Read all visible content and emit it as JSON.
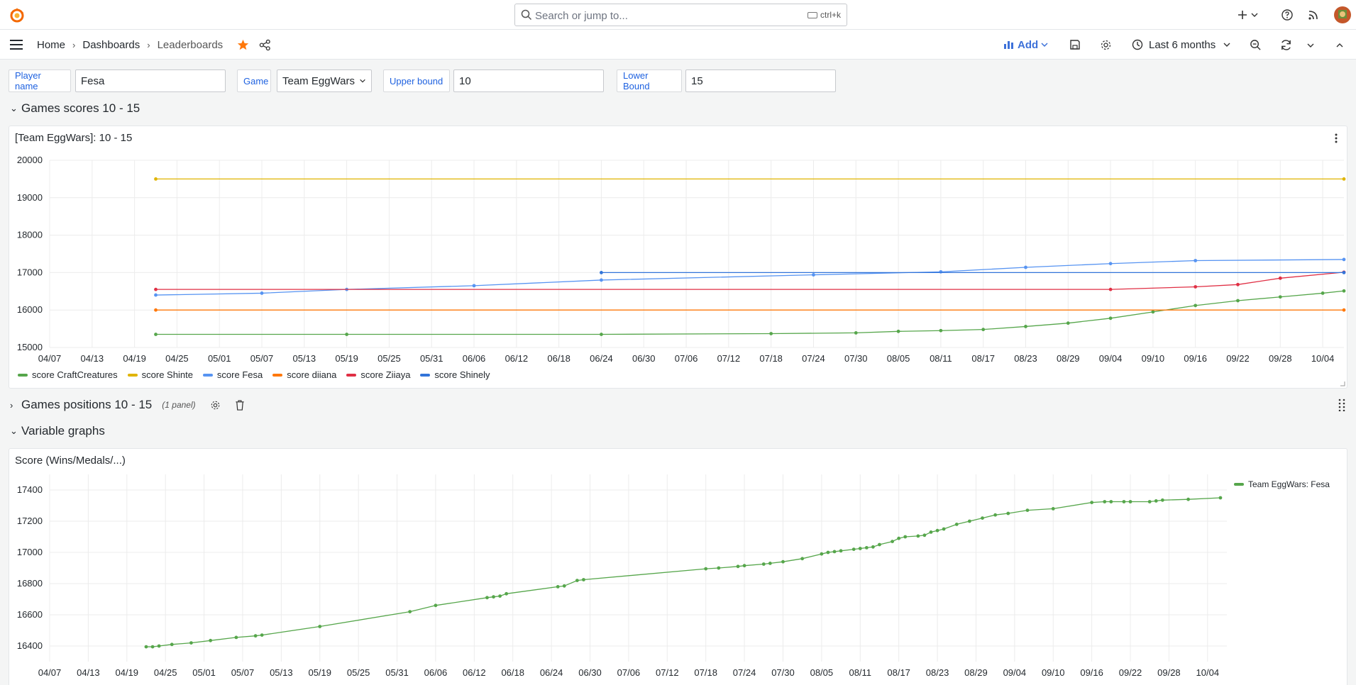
{
  "topbar": {
    "search_placeholder": "Search or jump to...",
    "search_shortcut": "ctrl+k",
    "icons": [
      "grafana-logo-icon",
      "plus-icon",
      "chevron-down-icon",
      "help-icon",
      "rss-icon",
      "user-avatar"
    ]
  },
  "navbar": {
    "breadcrumbs": [
      "Home",
      "Dashboards",
      "Leaderboards"
    ],
    "add_label": "Add",
    "time_range": "Last 6 months"
  },
  "variables": [
    {
      "label": "Player name",
      "value": "Fesa"
    },
    {
      "label": "Game",
      "value": "Team EggWars"
    },
    {
      "label": "Upper bound",
      "value": "10"
    },
    {
      "label": "Lower Bound",
      "value": "15"
    }
  ],
  "rows": {
    "games_scores": {
      "title": "Games scores 10 - 15"
    },
    "games_positions": {
      "title": "Games positions 10 - 15",
      "panel_count": "(1 panel)"
    },
    "variable_graphs": {
      "title": "Variable graphs"
    }
  },
  "colors": {
    "green": "#56a64b",
    "yellow": "#e0b400",
    "lightblue": "#5794f2",
    "orange": "#ff780a",
    "red": "#e02f44",
    "blue": "#3274d9",
    "accent": "#3d71d9",
    "star": "#ff780a"
  },
  "chart_data": [
    {
      "type": "line",
      "title": "[Team EggWars]: 10 - 15",
      "x_ticks": [
        "04/07",
        "04/13",
        "04/19",
        "04/25",
        "05/01",
        "05/07",
        "05/13",
        "05/19",
        "05/25",
        "05/31",
        "06/06",
        "06/12",
        "06/18",
        "06/24",
        "06/30",
        "07/06",
        "07/12",
        "07/18",
        "07/24",
        "07/30",
        "08/05",
        "08/11",
        "08/17",
        "08/23",
        "08/29",
        "09/04",
        "09/10",
        "09/16",
        "09/22",
        "09/28",
        "10/04"
      ],
      "ylim": [
        15000,
        20000
      ],
      "y_ticks": [
        15000,
        16000,
        17000,
        18000,
        19000,
        20000
      ],
      "grid": true,
      "legend_placement": "bottom",
      "series": [
        {
          "name": "score CraftCreatures",
          "color": "green",
          "x": [
            "04/22",
            "05/19",
            "06/24",
            "07/18",
            "07/30",
            "08/05",
            "08/11",
            "08/17",
            "08/23",
            "08/29",
            "09/04",
            "09/10",
            "09/16",
            "09/22",
            "09/28",
            "10/04",
            "10/07"
          ],
          "y": [
            15350,
            15350,
            15350,
            15370,
            15390,
            15430,
            15450,
            15480,
            15560,
            15650,
            15780,
            15950,
            16120,
            16250,
            16350,
            16450,
            16510
          ]
        },
        {
          "name": "score Shinte",
          "color": "yellow",
          "x": [
            "04/22",
            "10/07"
          ],
          "y": [
            19500,
            19500
          ]
        },
        {
          "name": "score Fesa",
          "color": "lightblue",
          "x": [
            "04/22",
            "05/07",
            "05/19",
            "06/06",
            "06/24",
            "07/24",
            "08/11",
            "08/23",
            "09/04",
            "09/16",
            "10/07"
          ],
          "y": [
            16400,
            16450,
            16550,
            16650,
            16800,
            16940,
            17020,
            17140,
            17240,
            17320,
            17350
          ]
        },
        {
          "name": "score diiana",
          "color": "orange",
          "x": [
            "04/22",
            "10/07"
          ],
          "y": [
            16000,
            16000
          ]
        },
        {
          "name": "score Ziiaya",
          "color": "red",
          "x": [
            "04/22",
            "09/04",
            "09/16",
            "09/22",
            "09/28",
            "10/07"
          ],
          "y": [
            16550,
            16550,
            16620,
            16680,
            16850,
            17010
          ]
        },
        {
          "name": "score Shinely",
          "color": "blue",
          "x": [
            "06/24",
            "10/07"
          ],
          "y": [
            17000,
            17000
          ]
        }
      ]
    },
    {
      "type": "line",
      "title": "Score (Wins/Medals/...)",
      "x_ticks": [
        "04/07",
        "04/13",
        "04/19",
        "04/25",
        "05/01",
        "05/07",
        "05/13",
        "05/19",
        "05/25",
        "05/31",
        "06/06",
        "06/12",
        "06/18",
        "06/24",
        "06/30",
        "07/06",
        "07/12",
        "07/18",
        "07/24",
        "07/30",
        "08/05",
        "08/11",
        "08/17",
        "08/23",
        "08/29",
        "09/04",
        "09/10",
        "09/16",
        "09/22",
        "09/28",
        "10/04"
      ],
      "ylim": [
        16300,
        17500
      ],
      "y_ticks": [
        16400,
        16600,
        16800,
        17000,
        17200,
        17400
      ],
      "grid": true,
      "legend_placement": "top-right",
      "series": [
        {
          "name": "Team EggWars: Fesa",
          "color": "green",
          "x": [
            "04/22",
            "04/23",
            "04/24",
            "04/26",
            "04/29",
            "05/02",
            "05/06",
            "05/09",
            "05/10",
            "05/19",
            "06/02",
            "06/06",
            "06/14",
            "06/15",
            "06/16",
            "06/17",
            "06/25",
            "06/26",
            "06/28",
            "06/29",
            "07/18",
            "07/20",
            "07/23",
            "07/24",
            "07/27",
            "07/28",
            "07/30",
            "08/02",
            "08/05",
            "08/06",
            "08/07",
            "08/08",
            "08/10",
            "08/11",
            "08/12",
            "08/13",
            "08/14",
            "08/16",
            "08/17",
            "08/18",
            "08/20",
            "08/21",
            "08/22",
            "08/23",
            "08/24",
            "08/26",
            "08/28",
            "08/30",
            "09/01",
            "09/03",
            "09/06",
            "09/10",
            "09/16",
            "09/18",
            "09/19",
            "09/21",
            "09/22",
            "09/25",
            "09/26",
            "09/27",
            "10/01",
            "10/06"
          ],
          "y": [
            16395,
            16395,
            16400,
            16410,
            16420,
            16435,
            16455,
            16465,
            16470,
            16525,
            16620,
            16660,
            16710,
            16715,
            16720,
            16735,
            16780,
            16785,
            16820,
            16825,
            16895,
            16900,
            16910,
            16915,
            16925,
            16930,
            16940,
            16960,
            16990,
            17000,
            17005,
            17010,
            17020,
            17025,
            17030,
            17035,
            17050,
            17070,
            17090,
            17100,
            17105,
            17110,
            17130,
            17140,
            17150,
            17180,
            17200,
            17220,
            17240,
            17250,
            17270,
            17280,
            17320,
            17325,
            17325,
            17325,
            17325,
            17325,
            17330,
            17335,
            17340,
            17350
          ]
        }
      ]
    }
  ]
}
